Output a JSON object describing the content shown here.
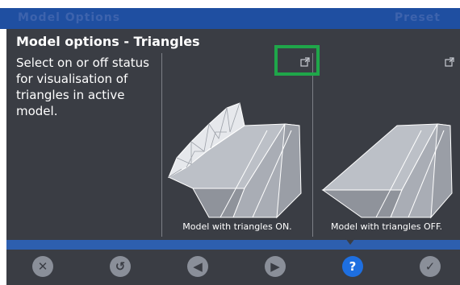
{
  "header": {
    "ghost_left": "Model Options",
    "ghost_right": "Preset"
  },
  "panel": {
    "title": "Model options - Triangles",
    "description": "Select on or off status for visualisation of triangles in active model.",
    "images": [
      {
        "caption": "Model with triangles ON.",
        "icon": "external-link-icon"
      },
      {
        "caption": "Model with triangles OFF.",
        "icon": "external-link-icon"
      }
    ]
  },
  "toolbar": {
    "buttons": [
      {
        "icon": "close-icon",
        "glyph": "✕"
      },
      {
        "icon": "reset-icon",
        "glyph": "↺"
      },
      {
        "icon": "previous-icon",
        "glyph": "◀"
      },
      {
        "icon": "next-icon",
        "glyph": "▶"
      },
      {
        "icon": "help-icon",
        "glyph": "?"
      },
      {
        "icon": "confirm-icon",
        "glyph": "✓"
      }
    ]
  },
  "colors": {
    "panel": "#3a3d44",
    "accent_blue": "#2d5faf",
    "help_blue": "#1e6fe0",
    "highlight_green": "#1fa64a"
  }
}
